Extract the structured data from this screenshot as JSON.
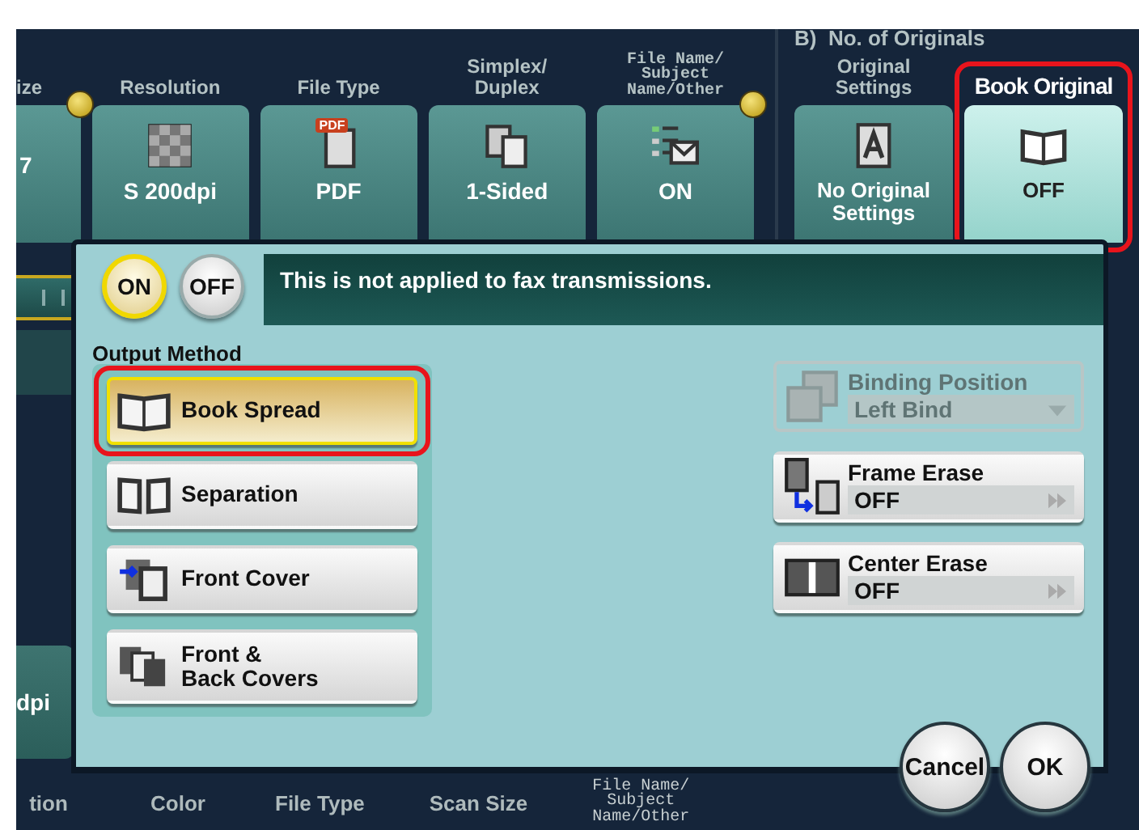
{
  "settings_tabs": [
    {
      "kind": "partial",
      "label": "ize",
      "value": "7",
      "changed": true,
      "selected": false,
      "highlighted": false
    },
    {
      "kind": "resolution",
      "label": "Resolution",
      "value": "S 200dpi",
      "changed": false,
      "selected": false,
      "highlighted": false
    },
    {
      "kind": "pdf",
      "label": "File Type",
      "value": "PDF",
      "icon_text": "PDF",
      "changed": false,
      "selected": false,
      "highlighted": false
    },
    {
      "kind": "duplex",
      "label": "Simplex/\nDuplex",
      "value": "1-Sided",
      "changed": false,
      "selected": false,
      "highlighted": false
    },
    {
      "kind": "file-name",
      "label": "File Name/\nSubject\nName/Other",
      "value": "ON",
      "changed": true,
      "selected": false,
      "highlighted": false
    }
  ],
  "originals_group": {
    "title": "B)  No. of Originals",
    "tabs": [
      {
        "kind": "original-settings",
        "label": "Original\nSettings",
        "value": "No Original Settings",
        "changed": false,
        "selected": false,
        "highlighted": false
      },
      {
        "kind": "book",
        "label": "Book Original",
        "value": "OFF",
        "changed": false,
        "selected": true,
        "highlighted": true
      }
    ]
  },
  "background": {
    "side_value": "dpi"
  },
  "dialog": {
    "toggle": [
      {
        "label": "ON",
        "selected": true
      },
      {
        "label": "OFF",
        "selected": false
      }
    ],
    "message": "This is not applied to fax transmissions.",
    "output_method": {
      "label": "Output Method",
      "options": [
        {
          "kind": "book-spread",
          "label": "Book Spread",
          "selected": true,
          "highlighted": true
        },
        {
          "kind": "separation",
          "label": "Separation",
          "selected": false,
          "highlighted": false
        },
        {
          "kind": "front-cover",
          "label": "Front Cover",
          "selected": false,
          "highlighted": false
        },
        {
          "kind": "front-back-covers",
          "label": "Front &\nBack Covers",
          "selected": false,
          "highlighted": false
        }
      ]
    },
    "settings": [
      {
        "kind": "dropdown",
        "label": "Binding Position",
        "value": "Left Bind",
        "disabled": true
      },
      {
        "kind": "frame-erase",
        "label": "Frame Erase",
        "value": "OFF",
        "disabled": false
      },
      {
        "kind": "center-erase",
        "label": "Center Erase",
        "value": "OFF",
        "disabled": false
      }
    ],
    "buttons": [
      {
        "label": "Cancel"
      },
      {
        "label": "OK"
      }
    ]
  },
  "bottom_tabs": [
    "tion",
    "Color",
    "File Type",
    "Scan Size",
    "File Name/\nSubject\nName/Other"
  ]
}
